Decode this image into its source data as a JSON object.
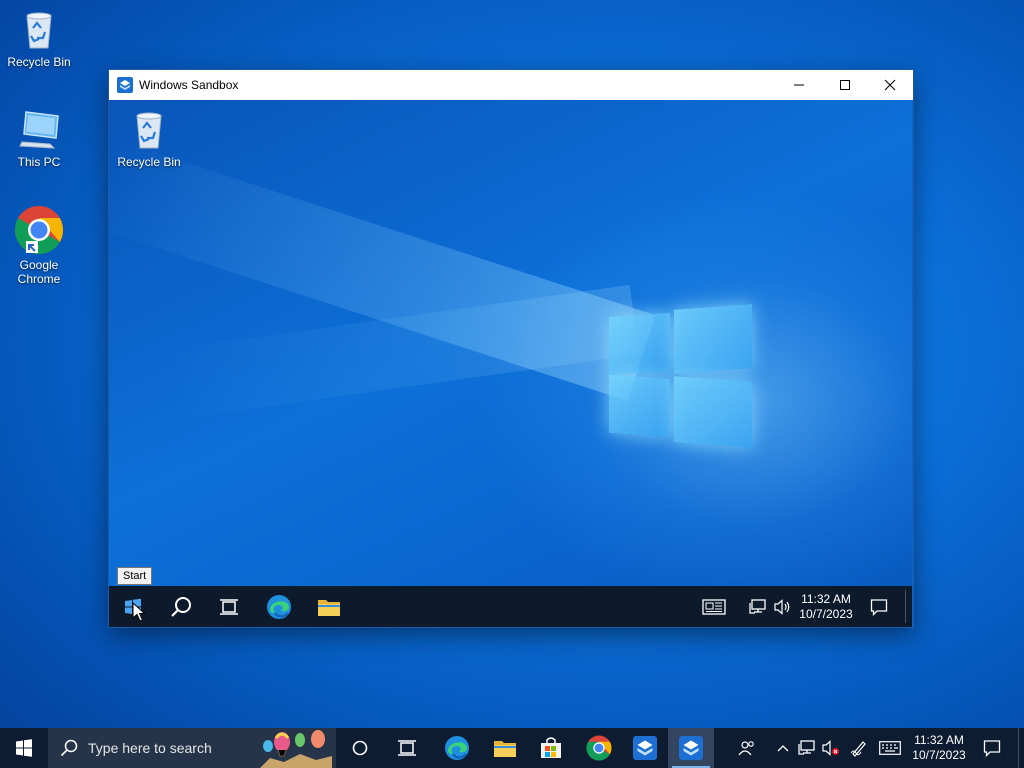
{
  "desktop": {
    "icons": [
      {
        "label": "Recycle Bin",
        "icon": "recycle-bin-icon"
      },
      {
        "label": "This PC",
        "icon": "computer-icon"
      },
      {
        "label": "Google Chrome",
        "icon": "chrome-icon"
      }
    ]
  },
  "window": {
    "title": "Windows Sandbox",
    "icon": "sandbox-icon",
    "buttons": [
      "minimize",
      "maximize",
      "close"
    ]
  },
  "sandbox_desktop": {
    "icons": [
      {
        "label": "Recycle Bin",
        "icon": "recycle-bin-icon"
      }
    ],
    "tooltip": "Start",
    "taskbar": {
      "apps": [
        "start",
        "search",
        "task-view",
        "edge",
        "file-explorer"
      ],
      "time": "11:32 AM",
      "date": "10/7/2023"
    }
  },
  "taskbar": {
    "search_placeholder": "Type here to search",
    "apps": [
      "cortana",
      "task-view",
      "edge",
      "file-explorer",
      "microsoft-store",
      "chrome",
      "windows-sandbox",
      "windows-sandbox-running"
    ],
    "time": "11:32 AM",
    "date": "10/7/2023"
  },
  "colors": {
    "desktop_bg": "#0a6fd8",
    "taskbar_bg": "#0d1c31",
    "accent": "#0078d7"
  }
}
